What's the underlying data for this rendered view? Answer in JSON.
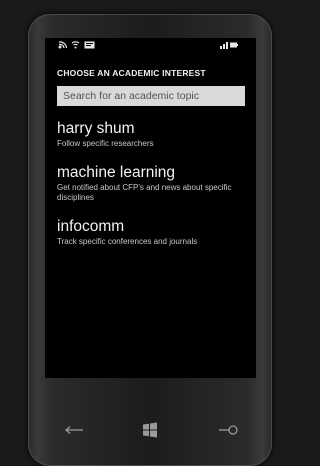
{
  "status_bar": {
    "icons_left": [
      "signal-icon",
      "wifi-icon",
      "message-icon"
    ],
    "icons_right": [
      "battery-icon"
    ]
  },
  "page": {
    "title": "CHOOSE AN ACADEMIC INTEREST"
  },
  "search": {
    "placeholder": "Search for an academic topic",
    "value": ""
  },
  "items": [
    {
      "title": "harry shum",
      "description": "Follow specific researchers"
    },
    {
      "title": "machine learning",
      "description": "Get notified about CFP's and news about specific disciplines"
    },
    {
      "title": "infocomm",
      "description": "Track specific conferences and journals"
    }
  ],
  "nav": {
    "buttons": [
      "back-icon",
      "windows-start-icon",
      "search-icon"
    ]
  },
  "colors": {
    "screen_bg": "#000000",
    "text": "#f2f2f2",
    "search_bg": "#d9d9d9"
  }
}
